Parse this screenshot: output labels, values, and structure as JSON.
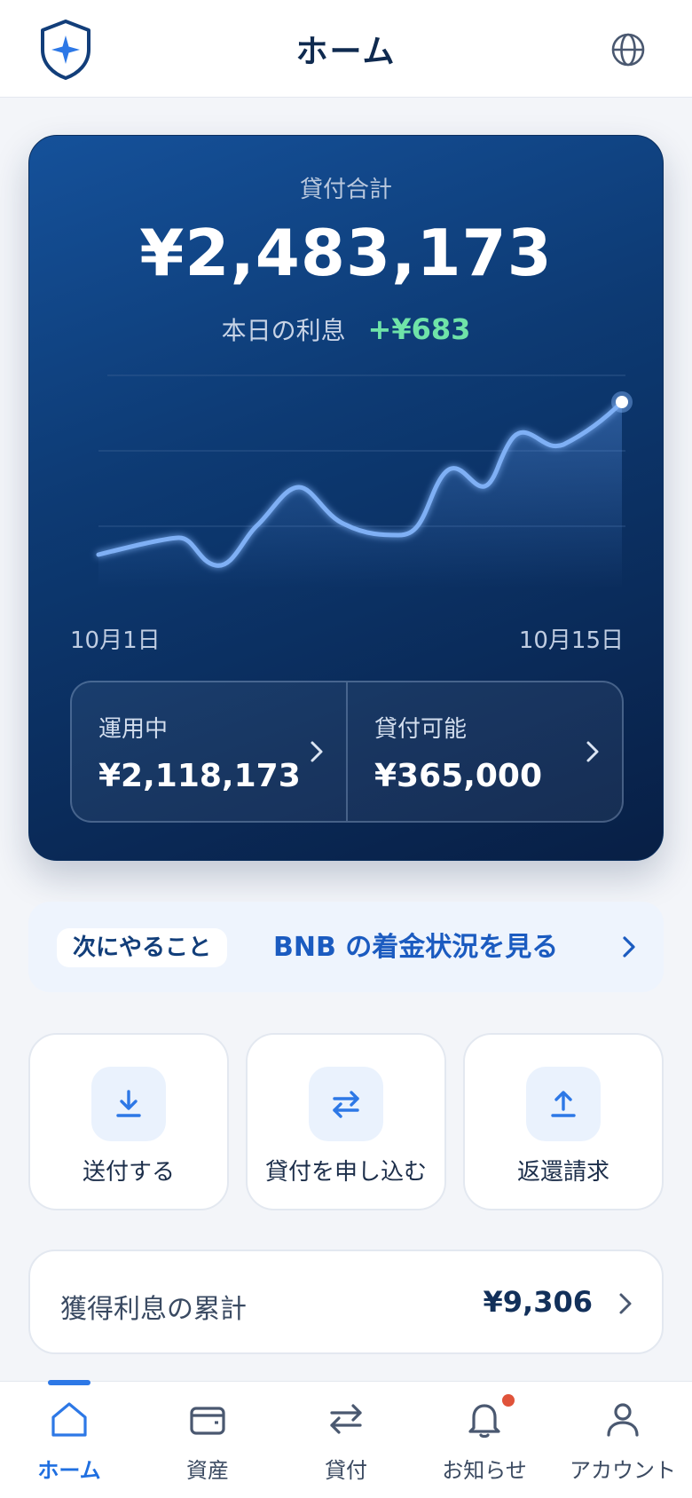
{
  "header": {
    "title": "ホーム"
  },
  "card": {
    "label": "貸付合計",
    "total": "¥2,483,173",
    "interest_label": "本日の利息",
    "interest_value": "+¥683",
    "date_start": "10月1日",
    "date_end": "10月15日",
    "in_use_label": "運用中",
    "in_use_value": "¥2,118,173",
    "available_label": "貸付可能",
    "available_value": "¥365,000"
  },
  "next": {
    "pill": "次にやること",
    "text": "BNB の着金状況を見る"
  },
  "actions": [
    {
      "label": "送付する",
      "icon": "download-icon"
    },
    {
      "label": "貸付を申し込む",
      "icon": "swap-icon"
    },
    {
      "label": "返還請求",
      "icon": "upload-icon"
    }
  ],
  "accumulated": {
    "label": "獲得利息の累計",
    "value": "¥9,306"
  },
  "nav": [
    {
      "label": "ホーム",
      "icon": "home-icon",
      "active": true
    },
    {
      "label": "資産",
      "icon": "wallet-icon",
      "active": false
    },
    {
      "label": "貸付",
      "icon": "swap-icon",
      "active": false
    },
    {
      "label": "お知らせ",
      "icon": "bell-icon",
      "active": false
    },
    {
      "label": "アカウント",
      "icon": "user-icon",
      "active": false
    }
  ],
  "colors": {
    "accent": "#2d78e6",
    "positive": "#6fe3a8",
    "card_dark": "#0a2a58",
    "badge": "#e0533a"
  }
}
